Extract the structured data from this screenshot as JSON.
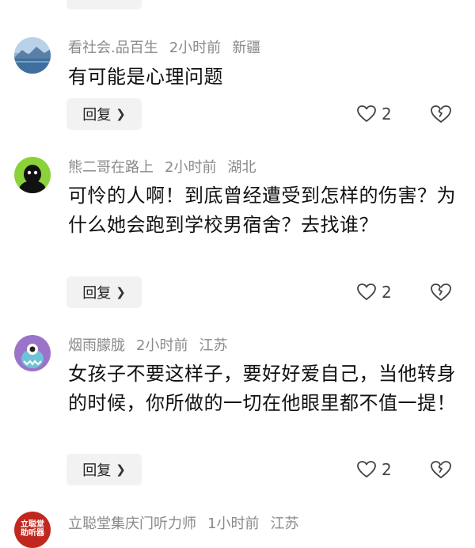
{
  "comments": [
    {
      "username": "看社会.品百生",
      "time": "2小时前",
      "location": "新疆",
      "text": "有可能是心理问题",
      "reply_label": "回复",
      "likes": "2",
      "avatar": "mountain-lake-avatar"
    },
    {
      "username": "熊二哥在路上",
      "time": "2小时前",
      "location": "湖北",
      "text": "可怜的人啊！到底曾经遭受到怎样的伤害？为什么她会跑到学校男宿舍？去找谁？",
      "reply_label": "回复",
      "likes": "2",
      "avatar": "black-figure-avatar"
    },
    {
      "username": "烟雨朦胧",
      "time": "2小时前",
      "location": "江苏",
      "text": "女孩子不要这样子，要好好爱自己，当他转身的时候，你所做的一切在他眼里都不值一提！",
      "reply_label": "回复",
      "likes": "2",
      "avatar": "monster-avatar"
    },
    {
      "username": "立聪堂集庆门听力师",
      "time": "1小时前",
      "location": "江苏",
      "avatar": "hearing-aid-logo-avatar",
      "avatar_text": "立聪堂 助听器"
    }
  ],
  "colors": {
    "meta_gray": "#8a8a8a",
    "button_bg": "#f2f2f2",
    "logo_red": "#c0281f"
  }
}
